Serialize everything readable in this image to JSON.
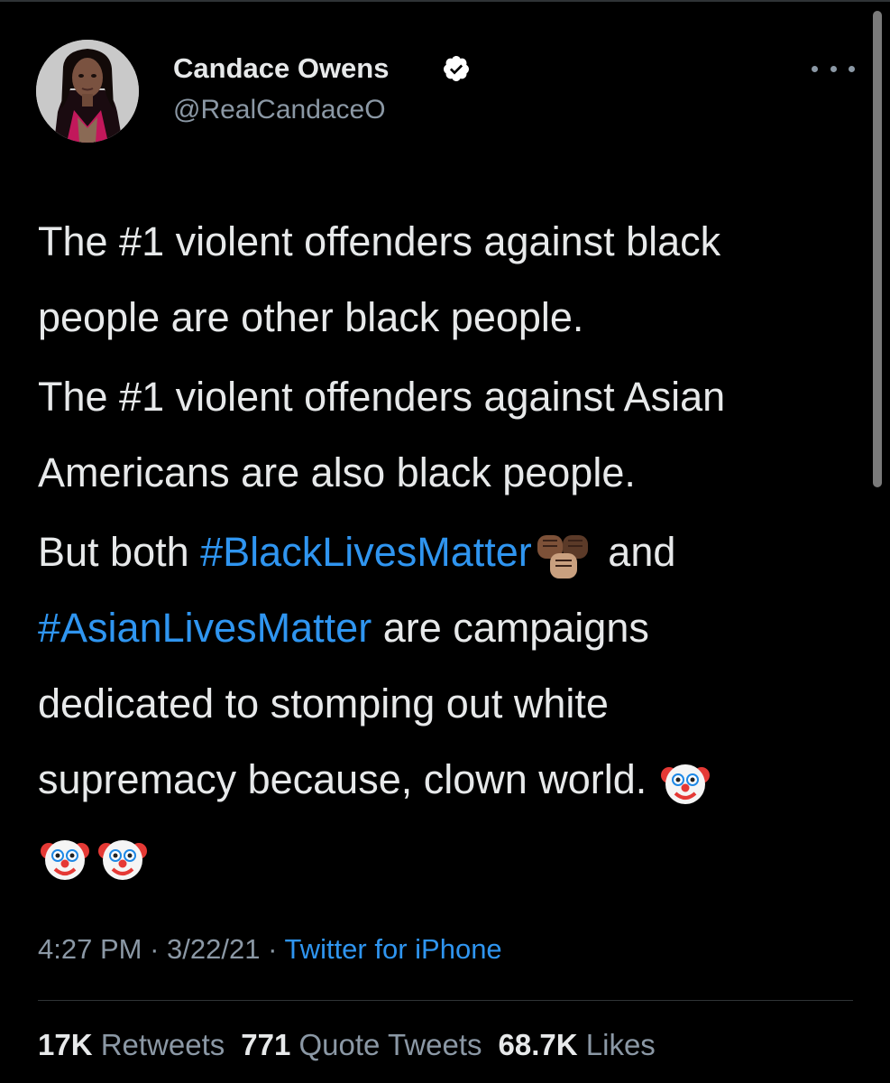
{
  "user": {
    "display_name": "Candace Owens",
    "handle": "@RealCandaceO",
    "verified": true,
    "avatar_icon": "profile-photo"
  },
  "more_icon": "ellipsis-icon",
  "tweet": {
    "para1_line1": "The #1 violent offenders against black",
    "para1_line2": "people are other black people.",
    "para2_line1": "The #1 violent offenders against Asian",
    "para2_line2": "Americans are also black people.",
    "para3_line1_start": "But both ",
    "hashtag1": "#BlackLivesMatter",
    "para3_line1_end": " and",
    "hashtag2": "#AsianLivesMatter",
    "para3_line2_end": " are campaigns",
    "para3_line3": "dedicated to stomping out white",
    "para3_line4": "supremacy because, clown world. ",
    "emojis": [
      "raised-fists-icon",
      "clown-face-icon",
      "clown-face-icon",
      "clown-face-icon"
    ]
  },
  "meta": {
    "time": "4:27 PM",
    "sep1": " · ",
    "date": "3/22/21",
    "sep2": " · ",
    "source": "Twitter for iPhone"
  },
  "stats": {
    "retweets_count": "17K",
    "retweets_label": "Retweets",
    "quotes_count": "771",
    "quotes_label": "Quote Tweets",
    "likes_count": "68.7K",
    "likes_label": "Likes"
  },
  "colors": {
    "background": "#000000",
    "text": "#e7e9ea",
    "secondary": "#8b98a5",
    "link": "#2f95f0",
    "verified": "#ffffff"
  }
}
